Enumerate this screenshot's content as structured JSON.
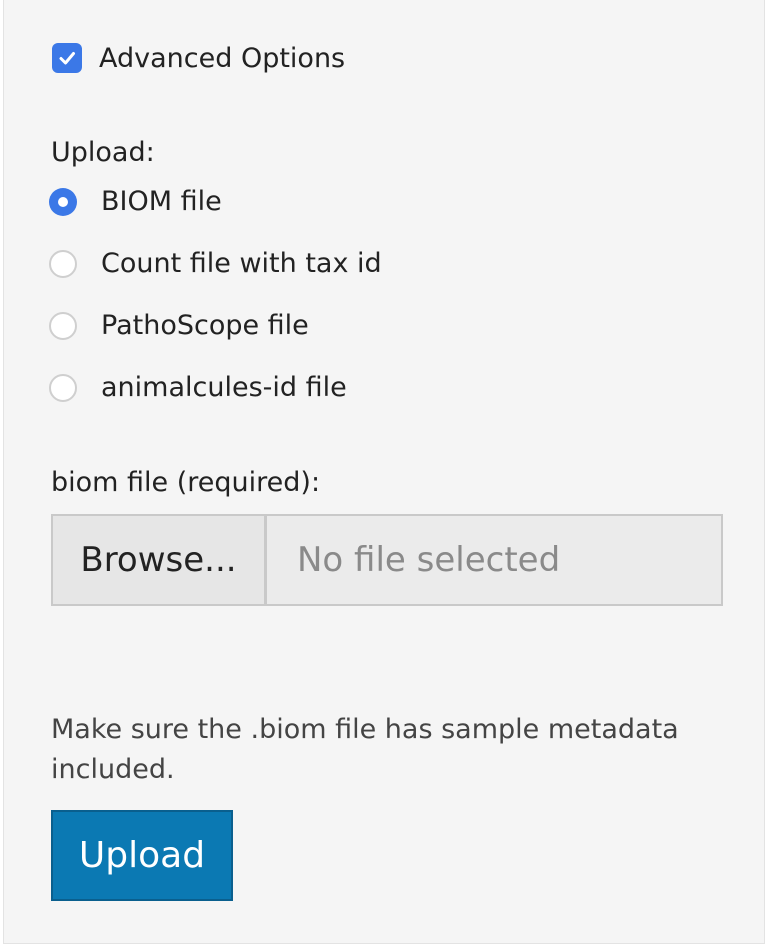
{
  "advanced_options": {
    "label": "Advanced Options",
    "checked": true
  },
  "upload": {
    "heading": "Upload:",
    "options": [
      {
        "label": "BIOM file",
        "selected": true
      },
      {
        "label": "Count file with tax id",
        "selected": false
      },
      {
        "label": "PathoScope file",
        "selected": false
      },
      {
        "label": "animalcules-id file",
        "selected": false
      }
    ]
  },
  "file_input": {
    "label": "biom file (required):",
    "browse_label": "Browse...",
    "placeholder": "No file selected"
  },
  "help_text": "Make sure the .biom file has sample metadata included.",
  "submit_label": "Upload",
  "colors": {
    "accent": "#3b78e7",
    "button_primary": "#0b79b3"
  },
  "icons": {
    "checkbox": "checkmark-icon"
  }
}
